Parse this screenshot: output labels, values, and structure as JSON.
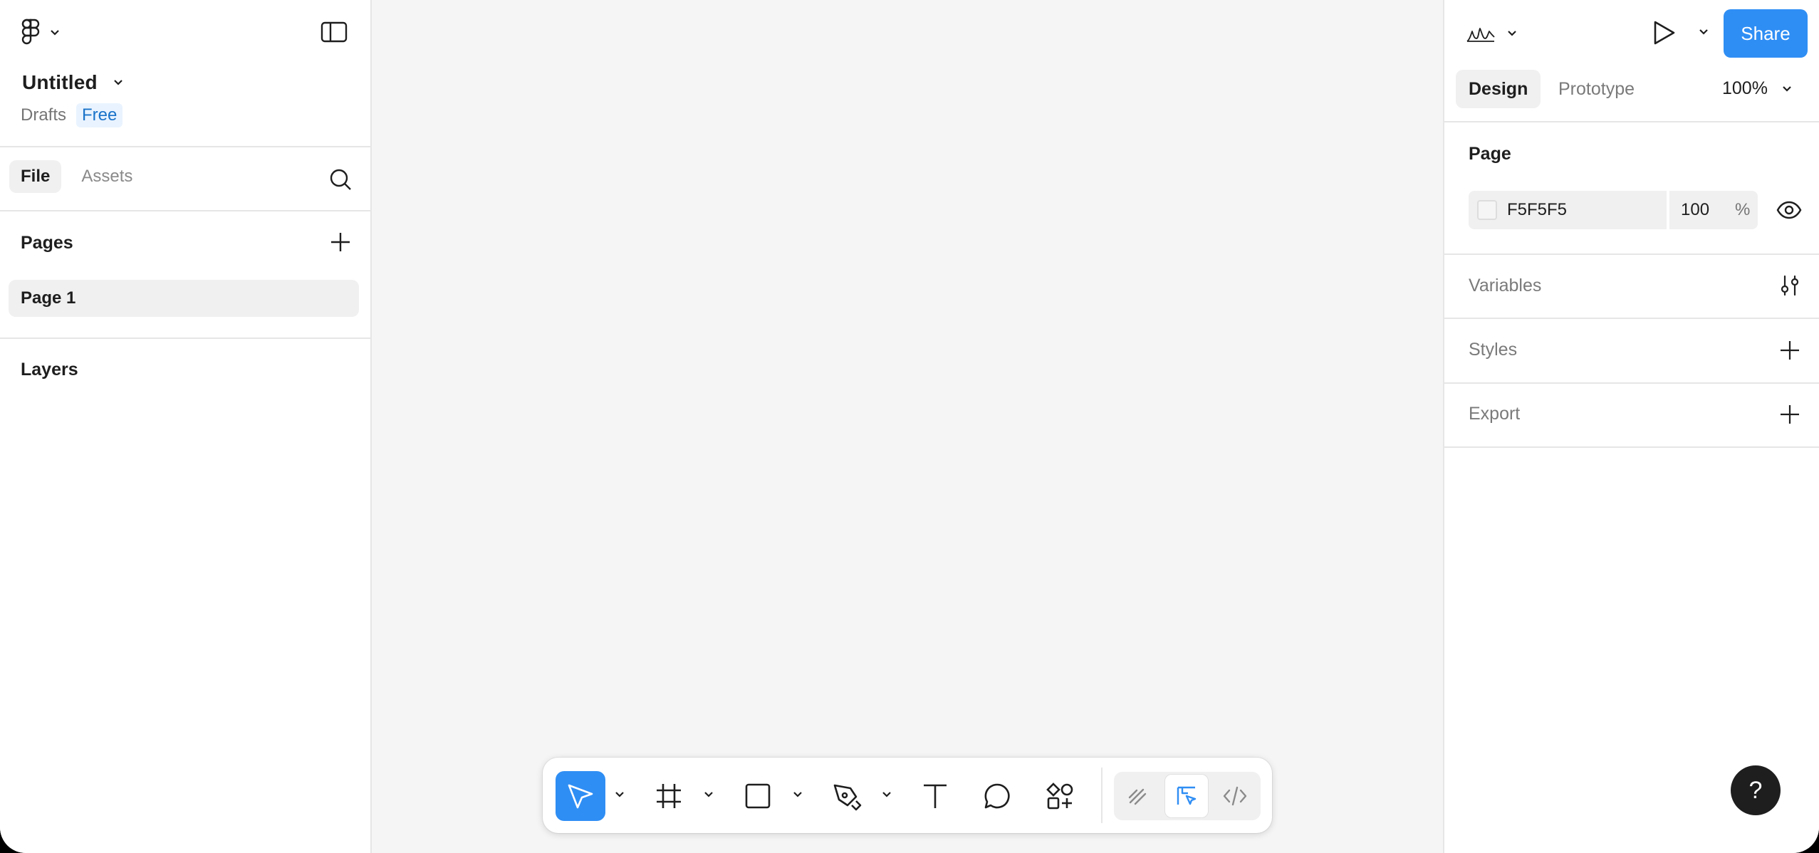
{
  "file": {
    "title": "Untitled",
    "location": "Drafts",
    "plan": "Free"
  },
  "left_tabs": {
    "file": "File",
    "assets": "Assets"
  },
  "pages": {
    "heading": "Pages",
    "items": [
      "Page 1"
    ]
  },
  "layers": {
    "heading": "Layers"
  },
  "header": {
    "share": "Share",
    "zoom": "100%"
  },
  "right_tabs": {
    "design": "Design",
    "prototype": "Prototype"
  },
  "page_props": {
    "heading": "Page",
    "color": "F5F5F5",
    "opacity": "100",
    "opacity_unit": "%"
  },
  "sections": {
    "variables": "Variables",
    "styles": "Styles",
    "export": "Export"
  },
  "help": {
    "label": "?"
  },
  "colors": {
    "accent": "#2f8ef4",
    "canvas": "#f5f5f5",
    "badge_text": "#1a73c9",
    "badge_bg": "#e9f3ff"
  },
  "icons": {
    "main_menu": "figma-logo-icon",
    "sidebar_toggle": "sidebar-toggle-icon",
    "search": "search-icon",
    "add_page": "plus-icon",
    "present": "play-icon",
    "multiplayer": "avatar-squiggle-icon",
    "variables": "sliders-icon",
    "visibility": "eye-icon",
    "tools": [
      "move-icon",
      "frame-icon",
      "rectangle-icon",
      "pen-icon",
      "text-icon",
      "comment-icon",
      "actions-icon"
    ],
    "modes": [
      "draw-mode-icon",
      "design-mode-icon",
      "dev-mode-icon"
    ]
  }
}
